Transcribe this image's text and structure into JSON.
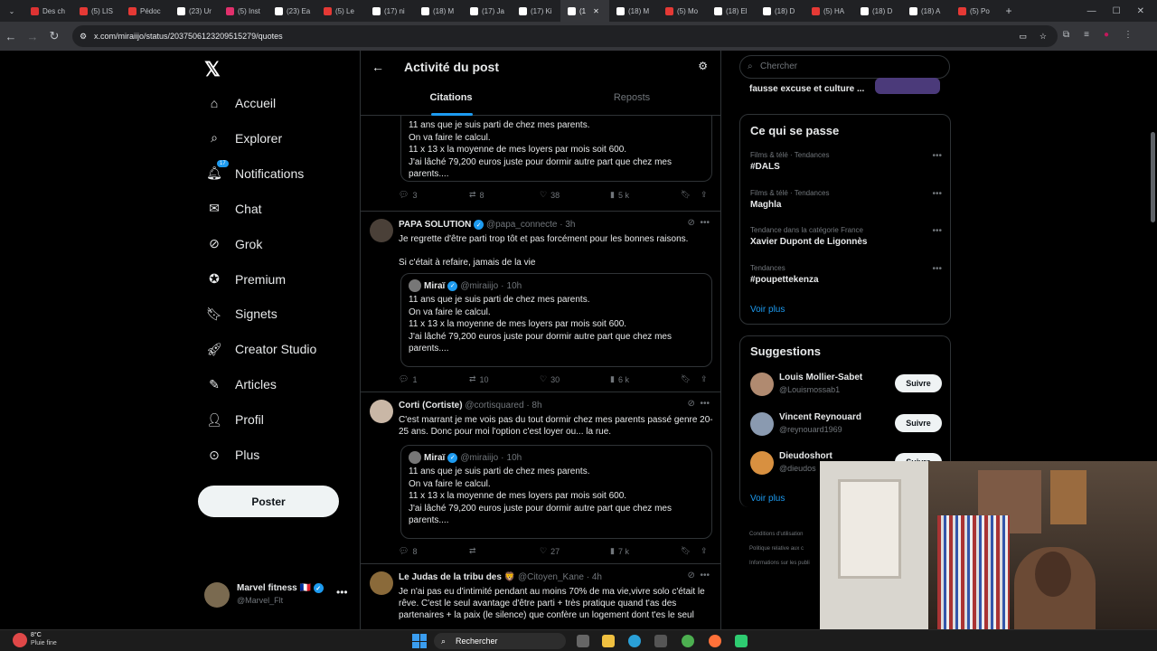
{
  "browser": {
    "tabs": [
      "Des ch",
      "(5) LIS",
      "Pédoc",
      "(23) Ur",
      "(5) Inst",
      "(23) Ea",
      "(5) Le",
      "(17) ni",
      "(18) M",
      "(17) Ja",
      "(17) Ki",
      "(1",
      "(18) M",
      "(5) Mo",
      "(18) El",
      "(18) D",
      "(5) HA",
      "(18) D",
      "(18) A",
      "(5) Po"
    ],
    "url": "x.com/miraiijo/status/2037506123209515279/quotes"
  },
  "nav": {
    "items": [
      {
        "label": "Accueil",
        "icon": "home-icon"
      },
      {
        "label": "Explorer",
        "icon": "search-icon"
      },
      {
        "label": "Notifications",
        "icon": "bell-icon",
        "badge": "17"
      },
      {
        "label": "Chat",
        "icon": "mail-icon"
      },
      {
        "label": "Grok",
        "icon": "grok-icon"
      },
      {
        "label": "Premium",
        "icon": "premium-icon"
      },
      {
        "label": "Signets",
        "icon": "bookmark-icon"
      },
      {
        "label": "Creator Studio",
        "icon": "rocket-icon"
      },
      {
        "label": "Articles",
        "icon": "article-icon"
      },
      {
        "label": "Profil",
        "icon": "person-icon"
      },
      {
        "label": "Plus",
        "icon": "more-circle-icon"
      }
    ],
    "post_label": "Poster",
    "account": {
      "name": "Marvel fitness 🇫🇷",
      "handle": "@Marvel_Flt"
    }
  },
  "header": {
    "title": "Activité du post",
    "tabs": [
      "Citations",
      "Reposts"
    ]
  },
  "tweets": [
    {
      "name": "",
      "handle": "",
      "time": "",
      "text": "",
      "quote": {
        "name": "",
        "handle": "",
        "time": "",
        "text": "11 ans que je suis parti de chez mes parents.\nOn va faire le calcul.\n11 x 13 x la moyenne de mes loyers par mois soit 600.\nJ'ai lâché 79,200 euros juste pour dormir autre part que chez mes parents...."
      },
      "replies": "3",
      "reposts": "8",
      "likes": "38",
      "views": "5 k"
    },
    {
      "name": "PAPA SOLUTION",
      "handle": "@papa_connecte",
      "time": "3h",
      "text": "Je regrette d'être parti trop tôt et pas forcément pour les bonnes raisons.\n\nSi c'était à refaire, jamais de la vie",
      "quote": {
        "name": "Miraï",
        "handle": "@miraiijo",
        "time": "10h",
        "text": "11 ans que je suis parti de chez mes parents.\nOn va faire le calcul.\n11 x 13 x la moyenne de mes loyers par mois soit 600.\nJ'ai lâché 79,200 euros juste pour dormir autre part que chez mes parents...."
      },
      "replies": "1",
      "reposts": "10",
      "likes": "30",
      "views": "6 k"
    },
    {
      "name": "Corti (Cortiste)",
      "handle": "@cortisquared",
      "time": "8h",
      "text": "C'est marrant je me vois pas du tout dormir chez mes parents passé genre 20-25 ans. Donc pour moi l'option c'est loyer ou... la rue.",
      "quote": {
        "name": "Miraï",
        "handle": "@miraiijo",
        "time": "10h",
        "text": "11 ans que je suis parti de chez mes parents.\nOn va faire le calcul.\n11 x 13 x la moyenne de mes loyers par mois soit 600.\nJ'ai lâché 79,200 euros juste pour dormir autre part que chez mes parents...."
      },
      "replies": "8",
      "reposts": "",
      "likes": "27",
      "views": "7 k"
    },
    {
      "name": "Le Judas de la tribu des 🦁",
      "handle": "@Citoyen_Kane",
      "time": "4h",
      "text": "Je n'ai pas eu d'intimité pendant au moins 70% de ma vie,vivre solo c'était le rêve. C'est le seul avantage d'être parti + très pratique quand t'as des partenaires + la paix (le silence) que confère un logement dont t'es le seul"
    }
  ],
  "sidebar": {
    "search_placeholder": "Chercher",
    "top_snippet": "fausse excuse et culture ...",
    "trending_title": "Ce qui se passe",
    "trends": [
      {
        "category": "Films & télé · Tendances",
        "name": "#DALS"
      },
      {
        "category": "Films & télé · Tendances",
        "name": "Maghla"
      },
      {
        "category": "Tendance dans la catégorie France",
        "name": "Xavier Dupont de Ligonnès"
      },
      {
        "category": "Tendances",
        "name": "#poupettekenza"
      }
    ],
    "see_more": "Voir plus",
    "suggestions_title": "Suggestions",
    "suggestions": [
      {
        "name": "Louis Mollier-Sabet",
        "handle": "@Louismossab1",
        "follow": "Suivre"
      },
      {
        "name": "Vincent Reynouard",
        "handle": "@reynouard1969",
        "follow": "Suivre"
      },
      {
        "name": "Dieudoshort",
        "handle": "@dieudos",
        "follow": "Suivre"
      }
    ],
    "footer": [
      "Conditions d'utilisation",
      "Politique relative aux c",
      "Informations sur les publi"
    ]
  },
  "taskbar": {
    "weather_temp": "8°C",
    "weather_desc": "Pluie fine",
    "search_label": "Rechercher"
  }
}
